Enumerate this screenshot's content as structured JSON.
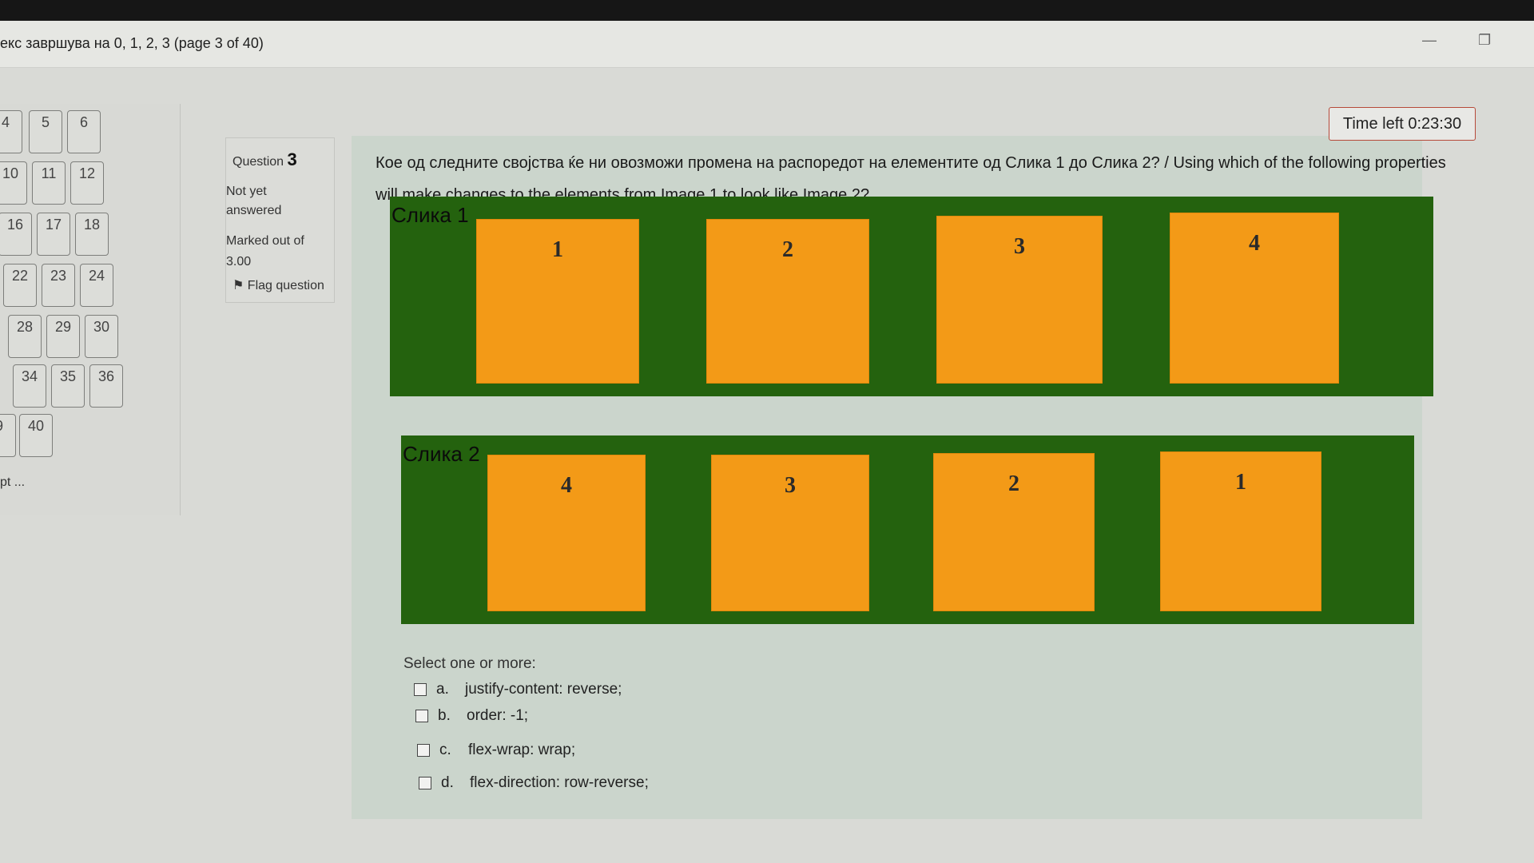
{
  "window": {
    "title": "екс завршува на 0, 1, 2, 3 (page 3 of 40)",
    "minimize_symbol": "—",
    "maximize_symbol": "❐"
  },
  "quiz_nav": {
    "buttons": [
      {
        "label": "4"
      },
      {
        "label": "5"
      },
      {
        "label": "6"
      },
      {
        "label": "10"
      },
      {
        "label": "11"
      },
      {
        "label": "12"
      },
      {
        "label": "16"
      },
      {
        "label": "17"
      },
      {
        "label": "18"
      },
      {
        "label": "22"
      },
      {
        "label": "23"
      },
      {
        "label": "24"
      },
      {
        "label": "28"
      },
      {
        "label": "29"
      },
      {
        "label": "30"
      },
      {
        "label": "34"
      },
      {
        "label": "35"
      },
      {
        "label": "36"
      },
      {
        "label": "9"
      },
      {
        "label": "40"
      }
    ],
    "finish_text": "pt ..."
  },
  "question_info": {
    "label": "Question",
    "number": "3",
    "status": "Not yet answered",
    "marked_out_of": "Marked out of 3.00",
    "flag_label": "Flag question"
  },
  "timer": {
    "text": "Time left 0:23:30"
  },
  "question": {
    "text": "Кое од следните својства ќе ни овозможи промена на распоредот на елементите од Слика 1 до Слика 2? / Using which of the following properties will make changes to the elements from Image 1 to look like Image 2?"
  },
  "figure1": {
    "label": "Слика 1",
    "boxes": [
      "1",
      "2",
      "3",
      "4"
    ]
  },
  "figure2": {
    "label": "Слика 2",
    "boxes": [
      "4",
      "3",
      "2",
      "1"
    ]
  },
  "answers": {
    "prompt": "Select one or more:",
    "options": [
      {
        "letter": "a.",
        "text": "justify-content: reverse;"
      },
      {
        "letter": "b.",
        "text": "order: -1;"
      },
      {
        "letter": "c.",
        "text": "flex-wrap: wrap;"
      },
      {
        "letter": "d.",
        "text": "flex-direction: row-reverse;"
      }
    ]
  },
  "colors": {
    "figure_bg": "#24620e",
    "box_fill": "#f39a17",
    "timer_border": "#b64a3a"
  }
}
